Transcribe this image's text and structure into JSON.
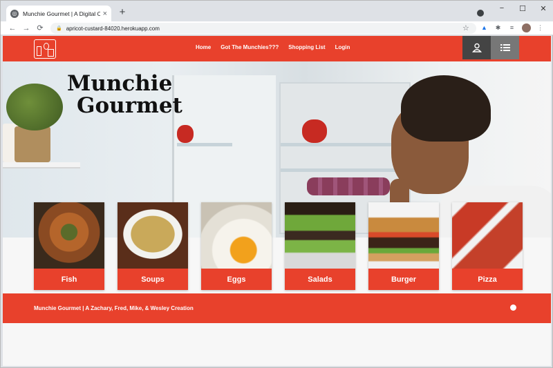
{
  "browser": {
    "tab_title": "Munchie Gourmet | A Digital Cre",
    "tab_close": "×",
    "new_tab": "+",
    "url": "apricot-custard-84020.herokuapp.com",
    "controls": {
      "minimize": "−",
      "maximize": "☐",
      "close": "✕"
    },
    "icons": [
      "back-icon",
      "forward-icon",
      "reload-icon",
      "lock-icon",
      "star-icon",
      "drive-icon",
      "extensions-icon",
      "reading-list-icon",
      "avatar",
      "menu-icon"
    ],
    "glyphs": {
      "back": "←",
      "forward": "→",
      "reload": "⟳",
      "lock": "🔒",
      "star": "☆",
      "ext1": "▲",
      "ext2": "✱",
      "ext3": "≡",
      "menu": "⋮"
    }
  },
  "site": {
    "colors": {
      "accent": "#e8412c",
      "dark": "#444444"
    },
    "nav": {
      "links": [
        "Home",
        "Got The Munchies???",
        "Shopping List",
        "Login"
      ],
      "icons": [
        "user-icon",
        "list-icon"
      ]
    },
    "hero": {
      "title_line1": "Munchie",
      "title_line2": "Gourmet"
    },
    "categories": [
      {
        "label": "Fish",
        "image": "fish-dish"
      },
      {
        "label": "Soups",
        "image": "soup-bowl"
      },
      {
        "label": "Eggs",
        "image": "poached-egg"
      },
      {
        "label": "Salads",
        "image": "salad-wraps"
      },
      {
        "label": "Burger",
        "image": "burger"
      },
      {
        "label": "Pizza",
        "image": "pizza"
      }
    ],
    "footer": {
      "text": "Munchie Gourmet | A Zachary, Fred, Mike, & Wesley Creation",
      "icon": "github-icon"
    }
  }
}
